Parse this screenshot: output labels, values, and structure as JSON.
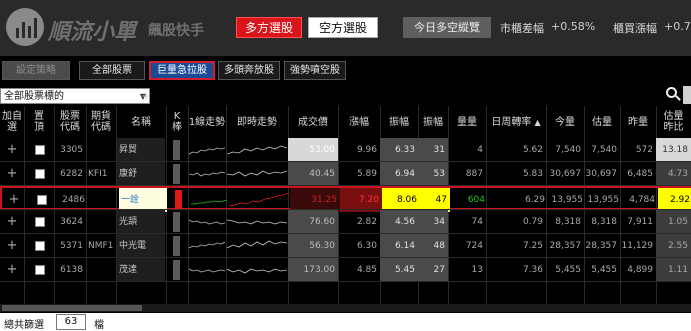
{
  "app": {
    "logo_text": "順流小單",
    "logo_sub": "飆股快手"
  },
  "header": {
    "long_label": "多方選股",
    "short_label": "空方選股",
    "bull_bear_label": "今日多空縱覽",
    "market_diff_label": "市櫃差幅",
    "market_diff_value": "+0.58%",
    "otc_change_label": "櫃買漲幅",
    "otc_change_value": "+0.7"
  },
  "toolbar": {
    "buttons": [
      {
        "label": "設定策略",
        "state": "disabled"
      },
      {
        "label": "全部股票",
        "state": "normal"
      },
      {
        "label": "巨量急拉股",
        "state": "active"
      },
      {
        "label": "多頭奔放股",
        "state": "normal"
      },
      {
        "label": "強勢噴空股",
        "state": "normal"
      }
    ]
  },
  "filter": {
    "selected": "全部股票標的"
  },
  "table": {
    "headers": [
      "加自\n選",
      "置\n頂",
      "股票\n代碼",
      "期貨\n代碼",
      "名稱",
      "K\n棒",
      "1線走勢",
      "即時走勢",
      "成交價",
      "漲幅",
      "振幅",
      "振幅",
      "量量",
      "日周轉率",
      "今量",
      "估量",
      "昨量",
      "估量\n昨比"
    ],
    "sort_indicator": "▲",
    "rows": [
      {
        "code": "3305",
        "fut": "",
        "name": "昇貿",
        "price": "53.00",
        "chg": "9.96",
        "amp": "6.33",
        "amp2": "31",
        "vol": "4",
        "turn": "5.62",
        "today": "7,540",
        "est": "7,540",
        "yest": "572",
        "ratio": "13.18"
      },
      {
        "code": "6282",
        "fut": "KFI1",
        "name": "康舒",
        "price": "40.45",
        "chg": "5.89",
        "amp": "6.94",
        "amp2": "53",
        "vol": "887",
        "turn": "5.83",
        "today": "30,697",
        "est": "30,697",
        "yest": "6,485",
        "ratio": "4.73"
      },
      {
        "code": "2486",
        "fut": "",
        "name": "一詮",
        "price": "31.25",
        "chg": "7.20",
        "amp": "8.06",
        "amp2": "47",
        "vol": "604",
        "turn": "6.29",
        "today": "13,955",
        "est": "13,955",
        "yest": "4,784",
        "ratio": "2.92"
      },
      {
        "code": "3624",
        "fut": "",
        "name": "光頡",
        "price": "76.60",
        "chg": "2.82",
        "amp": "4.56",
        "amp2": "34",
        "vol": "74",
        "turn": "0.79",
        "today": "8,318",
        "est": "8,318",
        "yest": "7,911",
        "ratio": "1.05"
      },
      {
        "code": "5371",
        "fut": "NMF1",
        "name": "中光電",
        "price": "56.30",
        "chg": "6.30",
        "amp": "6.14",
        "amp2": "48",
        "vol": "724",
        "turn": "7.25",
        "today": "28,357",
        "est": "28,357",
        "yest": "11,129",
        "ratio": "2.55"
      },
      {
        "code": "6138",
        "fut": "",
        "name": "茂達",
        "price": "173.00",
        "chg": "4.85",
        "amp": "5.45",
        "amp2": "27",
        "vol": "13",
        "turn": "7.36",
        "today": "5,455",
        "est": "5,455",
        "yest": "4,899",
        "ratio": "1.11"
      },
      {
        "code": "",
        "fut": "",
        "name": "",
        "price": "",
        "chg": "",
        "amp": "",
        "amp2": "",
        "vol": "",
        "turn": "",
        "today": "",
        "est": "",
        "yest": "",
        "ratio": ""
      }
    ]
  },
  "footer": {
    "label": "總共篩選",
    "count": "63",
    "unit": "檔"
  },
  "colors": {
    "accent_red": "#d9151b",
    "active_blue": "#1c4b96",
    "highlight_yellow": "#ffff00",
    "up_green": "#22c022"
  },
  "icons": [
    "logo-icon",
    "search-icon",
    "chevron-down-icon",
    "plus-icon",
    "checkbox-icon",
    "sort-up-icon"
  ]
}
